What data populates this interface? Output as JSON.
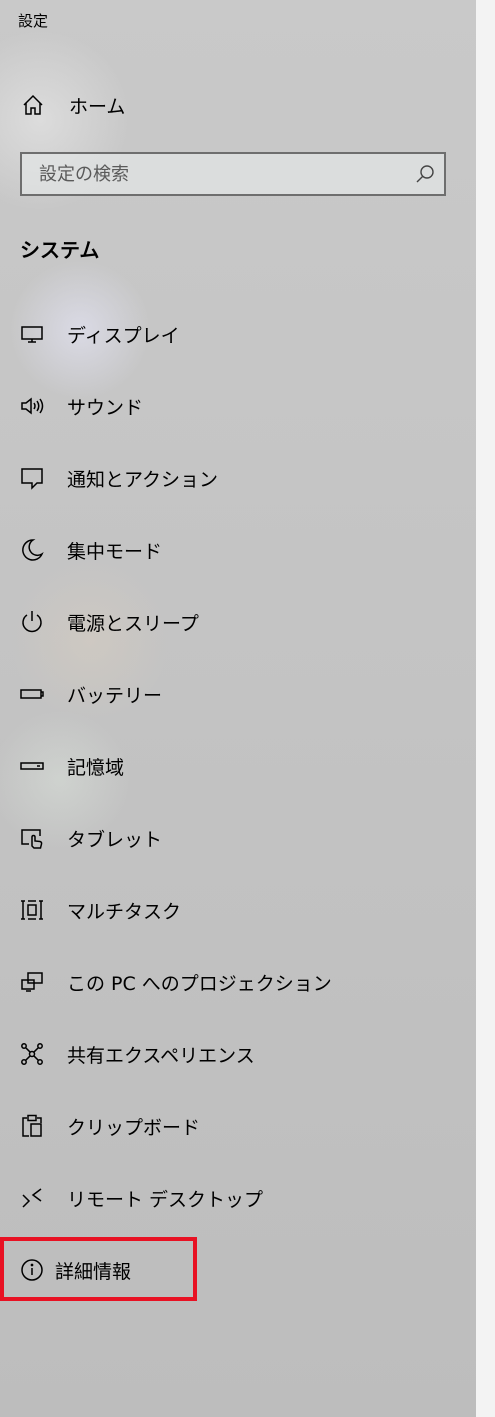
{
  "window": {
    "title": "設定"
  },
  "home": {
    "label": "ホーム",
    "icon": "home-icon"
  },
  "search": {
    "placeholder": "設定の検索",
    "value": "",
    "icon": "search-icon"
  },
  "section": {
    "title": "システム"
  },
  "nav": {
    "items": [
      {
        "label": "ディスプレイ",
        "icon": "monitor-icon"
      },
      {
        "label": "サウンド",
        "icon": "speaker-icon"
      },
      {
        "label": "通知とアクション",
        "icon": "notification-icon"
      },
      {
        "label": "集中モード",
        "icon": "moon-icon"
      },
      {
        "label": "電源とスリープ",
        "icon": "power-icon"
      },
      {
        "label": "バッテリー",
        "icon": "battery-icon"
      },
      {
        "label": "記憶域",
        "icon": "storage-icon"
      },
      {
        "label": "タブレット",
        "icon": "tablet-icon"
      },
      {
        "label": "マルチタスク",
        "icon": "multitask-icon"
      },
      {
        "label": "この PC へのプロジェクション",
        "icon": "projection-icon"
      },
      {
        "label": "共有エクスペリエンス",
        "icon": "shared-experience-icon"
      },
      {
        "label": "クリップボード",
        "icon": "clipboard-icon"
      },
      {
        "label": "リモート デスクトップ",
        "icon": "remote-desktop-icon"
      },
      {
        "label": "詳細情報",
        "icon": "info-icon"
      }
    ]
  },
  "highlight": {
    "color": "#e81123",
    "target": "詳細情報"
  }
}
